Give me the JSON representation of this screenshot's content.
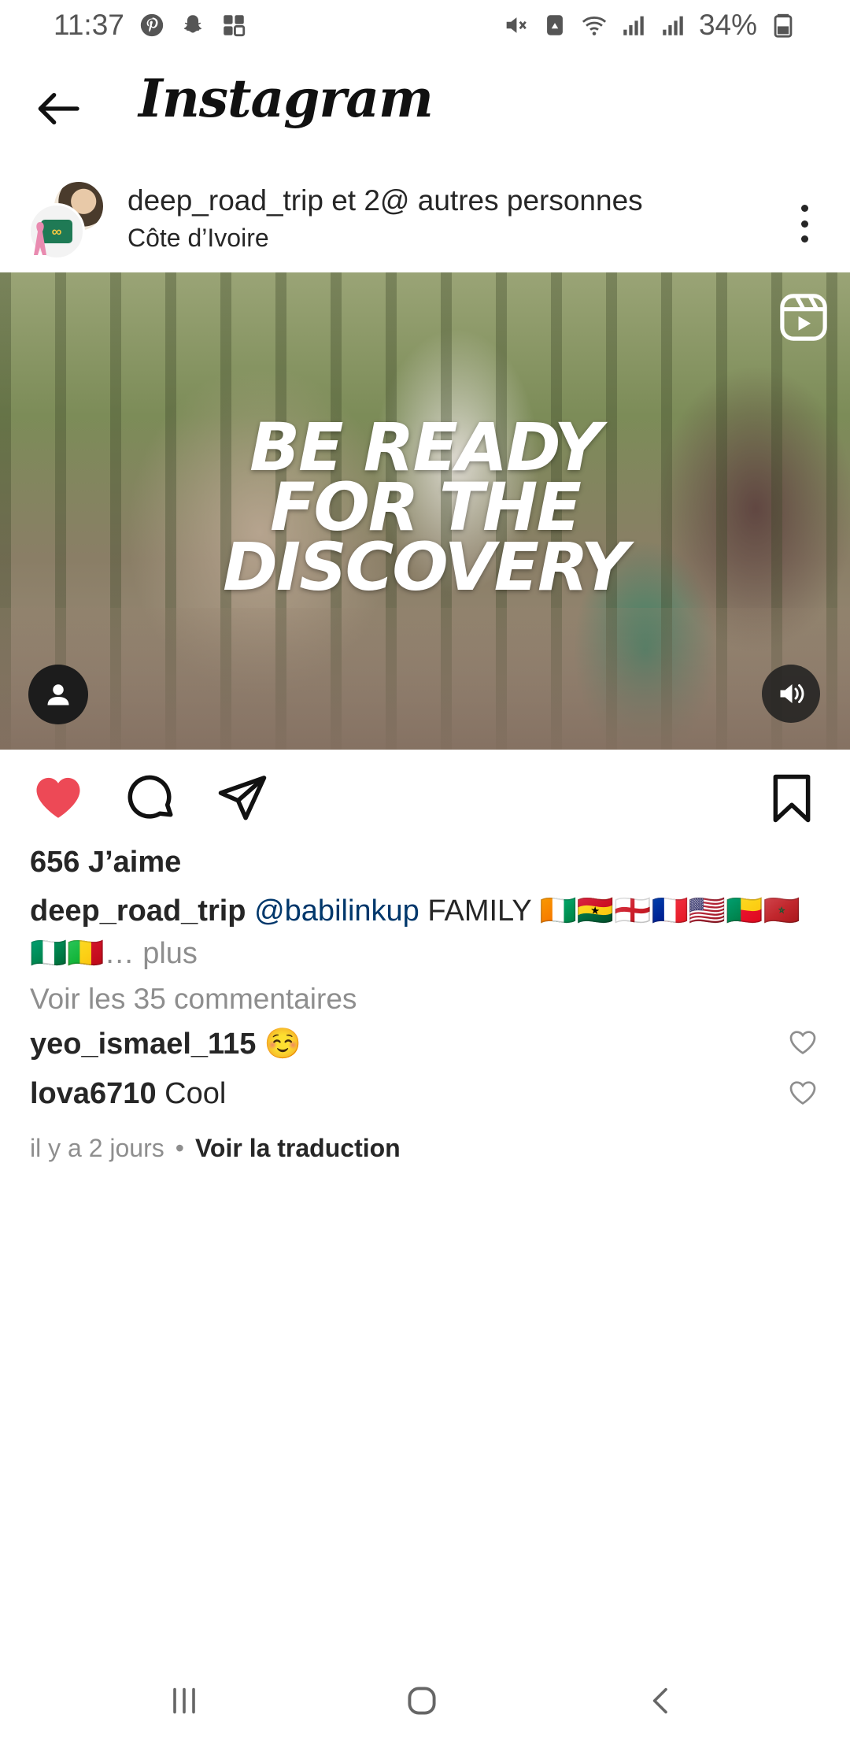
{
  "status_bar": {
    "time": "11:37",
    "battery": "34%",
    "left_icons": [
      "pinterest-icon",
      "snapchat-icon",
      "gallery-icon"
    ],
    "right_icons": [
      "mute-icon",
      "data-saver-icon",
      "wifi-icon",
      "signal-icon",
      "signal-icon",
      "battery-icon"
    ]
  },
  "header": {
    "title": "Instagram"
  },
  "post": {
    "username": "deep_road_trip",
    "coauthors": " et 2@ autres personnes",
    "location": "Côte d’Ivoire",
    "media_headline": [
      "BE READY",
      "FOR THE",
      "DISCOVERY"
    ]
  },
  "actions": {
    "liked": true,
    "like_color": "#ed4956"
  },
  "likes": "656 J’aime",
  "caption": {
    "username": "deep_road_trip",
    "mention": "@babilinkup",
    "text": "  FAMILY 🇨🇮🇬🇭🏴󠁧󠁢󠁥󠁮󠁧󠁿🇫🇷🇺🇸🇧🇯🇲🇦🇳🇬🇲🇱",
    "more": "… plus"
  },
  "view_comments": "Voir les 35 commentaires",
  "comments": [
    {
      "username": "yeo_ismael_115",
      "text": " ☺️"
    },
    {
      "username": "lova6710",
      "text": " Cool"
    }
  ],
  "meta": {
    "age": "il y a 2 jours",
    "separator": "•",
    "translate": "Voir la traduction"
  }
}
